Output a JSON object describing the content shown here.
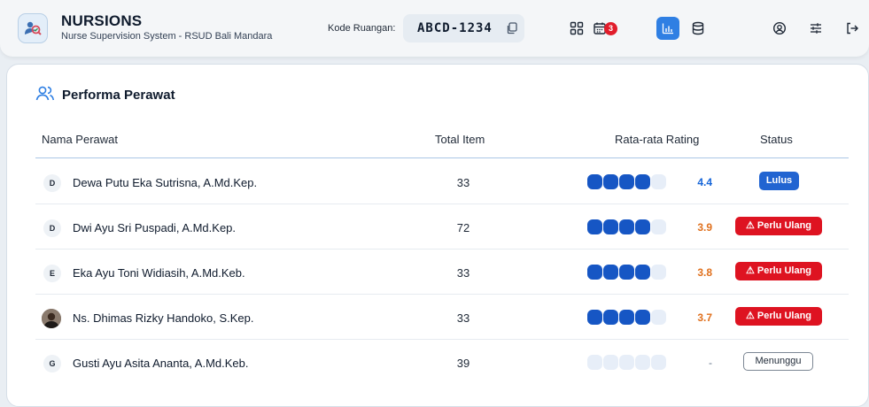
{
  "app": {
    "title": "NURSIONS",
    "subtitle": "Nurse Supervision System - RSUD Bali Mandara"
  },
  "room": {
    "label": "Kode Ruangan:",
    "code": "ABCD-1234"
  },
  "nav": {
    "notification_count": "3",
    "active_item": "chart"
  },
  "icons": {
    "logo": "supervision-logo-icon",
    "copy": "copy-icon",
    "grid": "grid-icon",
    "calendar": "calendar-icon",
    "chart": "bar-chart-icon",
    "database": "database-icon",
    "account": "user-circle-icon",
    "settings": "sliders-icon",
    "logout": "logout-icon",
    "users": "users-icon"
  },
  "colors": {
    "accent": "#2f7fe3",
    "rating_high": "#1565d8",
    "rating_low": "#e0701d",
    "pass": "#2164d1",
    "redo": "#de1321"
  },
  "performance": {
    "title": "Performa Perawat",
    "columns": {
      "name": "Nama Perawat",
      "total": "Total Item",
      "rating": "Rata-rata Rating",
      "status": "Status"
    },
    "rows": [
      {
        "initial": "D",
        "name": "Dewa Putu Eka Sutrisna, A.Md.Kep.",
        "total": "33",
        "rating": "4.4",
        "filled": 4,
        "status": "Lulus",
        "status_type": "pass",
        "tone": "high"
      },
      {
        "initial": "D",
        "name": "Dwi Ayu Sri Puspadi, A.Md.Kep.",
        "total": "72",
        "rating": "3.9",
        "filled": 4,
        "status": "⚠ Perlu Ulang",
        "status_type": "redo",
        "tone": "low"
      },
      {
        "initial": "E",
        "name": "Eka Ayu Toni Widiasih, A.Md.Keb.",
        "total": "33",
        "rating": "3.8",
        "filled": 4,
        "status": "⚠ Perlu Ulang",
        "status_type": "redo",
        "tone": "low"
      },
      {
        "initial": "",
        "name": "Ns. Dhimas Rizky Handoko, S.Kep.",
        "total": "33",
        "rating": "3.7",
        "filled": 4,
        "status": "⚠ Perlu Ulang",
        "status_type": "redo",
        "tone": "low",
        "photo": true
      },
      {
        "initial": "G",
        "name": "Gusti Ayu Asita Ananta, A.Md.Keb.",
        "total": "39",
        "rating": "-",
        "filled": 0,
        "status": "Menunggu",
        "status_type": "wait",
        "tone": "none"
      }
    ]
  }
}
